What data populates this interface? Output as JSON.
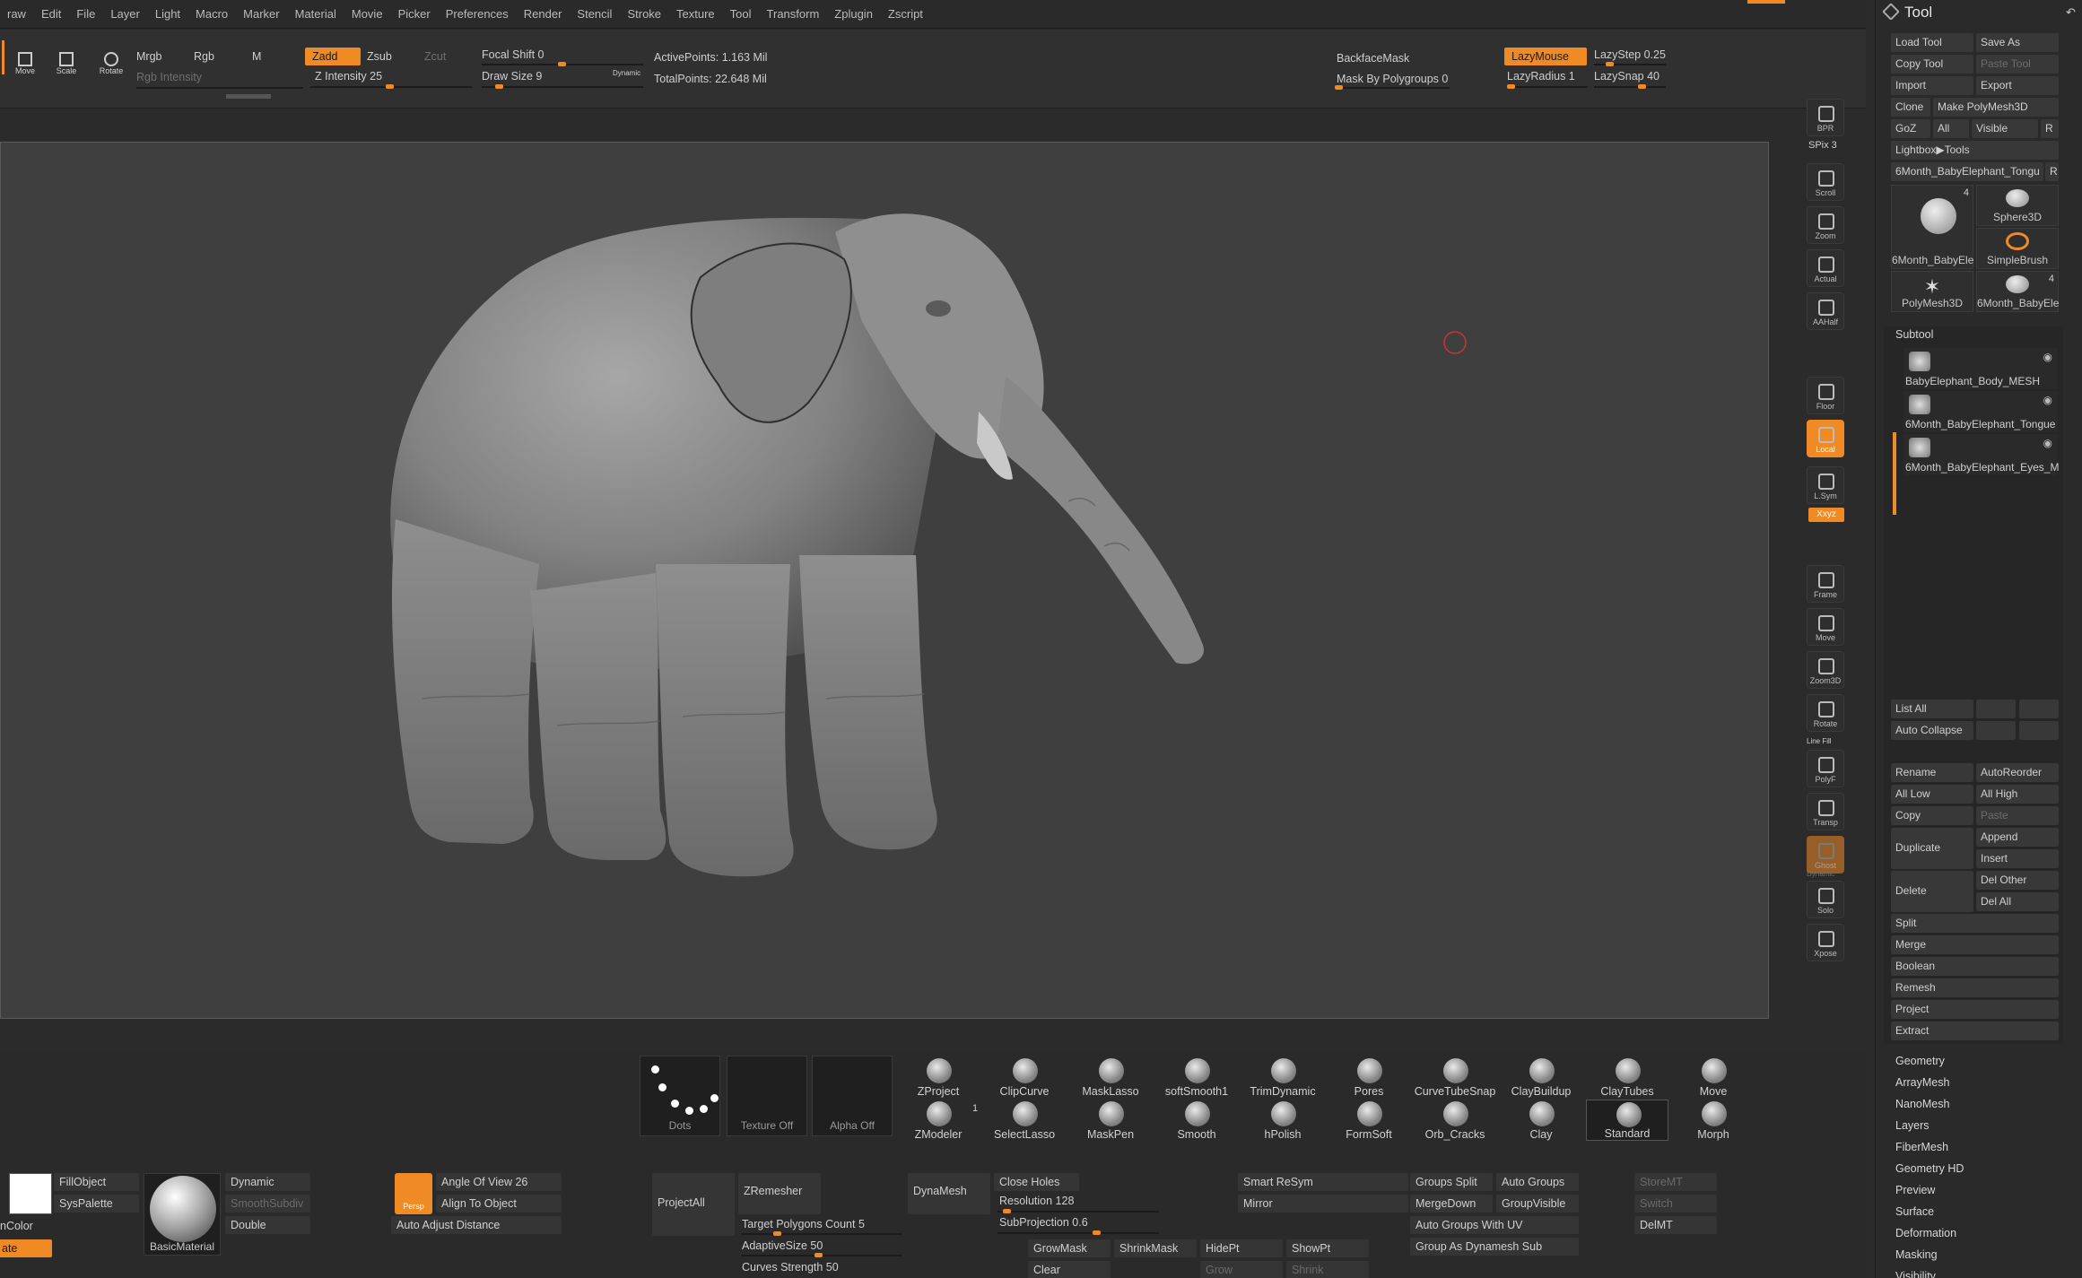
{
  "menu": [
    "raw",
    "Edit",
    "File",
    "Layer",
    "Light",
    "Macro",
    "Marker",
    "Material",
    "Movie",
    "Picker",
    "Preferences",
    "Render",
    "Stencil",
    "Stroke",
    "Texture",
    "Tool",
    "Transform",
    "Zplugin",
    "Zscript"
  ],
  "topshelf": {
    "transform_buttons": [
      "Move",
      "Scale",
      "Rotate"
    ],
    "mrgb": "Mrgb",
    "rgb": "Rgb",
    "m": "M",
    "rgb_intensity": "Rgb Intensity",
    "zadd": "Zadd",
    "zsub": "Zsub",
    "zcut": "Zcut",
    "z_intensity": "Z Intensity 25",
    "focal_shift": "Focal Shift 0",
    "draw_size": "Draw Size 9",
    "dynamic": "Dynamic",
    "active_points": "ActivePoints: 1.163 Mil",
    "total_points": "TotalPoints: 22.648 Mil",
    "backface_mask": "BackfaceMask",
    "mask_by_polygroups": "Mask By Polygroups 0",
    "lazymouse": "LazyMouse",
    "lazystep": "LazyStep 0.25",
    "lazyradius": "LazyRadius 1",
    "lazysnap": "LazySnap 40"
  },
  "right_toolbar": {
    "bpr": "BPR",
    "spix": "SPix 3",
    "scroll": "Scroll",
    "zoom": "Zoom",
    "actual": "Actual",
    "aahalf": "AAHalf",
    "floor": "Floor",
    "local": "Local",
    "lsym": "L.Sym",
    "xyz": "Xxyz",
    "frame": "Frame",
    "move": "Move",
    "zoom3d": "Zoom3D",
    "rotate": "Rotate",
    "linefill": "Line Fill",
    "polyf": "PolyF",
    "transp": "Transp",
    "ghost": "Ghost",
    "dynamic": "Dynamic",
    "solo": "Solo",
    "xpose": "Xpose"
  },
  "tool_panel": {
    "title": "Tool",
    "load_tool": "Load Tool",
    "save_as": "Save As",
    "copy_tool": "Copy Tool",
    "paste_tool": "Paste Tool",
    "import": "Import",
    "export": "Export",
    "clone": "Clone",
    "make_polymesh": "Make PolyMesh3D",
    "goz": "GoZ",
    "all": "All",
    "visible": "Visible",
    "r": "R",
    "lightbox_tools": "Lightbox▶Tools",
    "current_tool": "6Month_BabyElephant_Tongu",
    "current_r": "R",
    "tools": [
      {
        "name": "6Month_BabyEle",
        "count": "4"
      },
      {
        "name": "Sphere3D"
      },
      {
        "name": "SimpleBrush"
      },
      {
        "name": "PolyMesh3D"
      },
      {
        "name": "6Month_BabyEle",
        "count": "4"
      }
    ],
    "subtool_title": "Subtool",
    "subtools": [
      "BabyElephant_Body_MESH",
      "6Month_BabyElephant_Tongue",
      "6Month_BabyElephant_Eyes_M"
    ],
    "list_all": "List All",
    "auto_collapse": "Auto Collapse",
    "rename": "Rename",
    "autoreorder": "AutoReorder",
    "all_low": "All Low",
    "all_high": "All High",
    "copy": "Copy",
    "paste": "Paste",
    "duplicate": "Duplicate",
    "append": "Append",
    "insert": "Insert",
    "delete": "Delete",
    "del_other": "Del Other",
    "del_all": "Del All",
    "sections1": [
      "Split",
      "Merge",
      "Boolean",
      "Remesh",
      "Project",
      "Extract"
    ],
    "sections2": [
      "Geometry",
      "ArrayMesh",
      "NanoMesh",
      "Layers",
      "FiberMesh",
      "Geometry HD",
      "Preview",
      "Surface",
      "Deformation",
      "Masking",
      "Visibility"
    ]
  },
  "bottom": {
    "dots": "Dots",
    "texture_off": "Texture Off",
    "alpha_off": "Alpha Off",
    "brushes_row1": [
      "ZProject",
      "ClipCurve",
      "MaskLasso",
      "softSmooth1",
      "TrimDynamic",
      "Pores",
      "CurveTubeSnap",
      "ClayBuildup",
      "ClayTubes",
      "Move"
    ],
    "brushes_row2": [
      "ZModeler",
      "SelectLasso",
      "MaskPen",
      "Smooth",
      "hPolish",
      "FormSoft",
      "Orb_Cracks",
      "Clay",
      "Standard",
      "Morph"
    ],
    "zmodeler_num": "1",
    "fillobject": "FillObject",
    "syspalette": "SysPalette",
    "color": "nColor",
    "rotate_btn": "ate",
    "basic_material": "BasicMaterial",
    "mat_dynamic": "Dynamic",
    "smooth_subdiv": "SmoothSubdiv",
    "double": "Double",
    "persp": "Persp",
    "angle_of_view": "Angle Of View 26",
    "align_to_object": "Align To Object",
    "auto_adjust_distance": "Auto Adjust Distance",
    "projectall": "ProjectAll",
    "zremesher": "ZRemesher",
    "target_polygons": "Target Polygons Count 5",
    "adaptive_size": "AdaptiveSize 50",
    "curves_strength": "Curves Strength 50",
    "dynamesh": "DynaMesh",
    "close_holes": "Close Holes",
    "resolution": "Resolution 128",
    "subprojection": "SubProjection 0.6",
    "growmask": "GrowMask",
    "shrinkmask": "ShrinkMask",
    "hidept": "HidePt",
    "showpt": "ShowPt",
    "clear": "Clear",
    "grow": "Grow",
    "shrink": "Shrink",
    "smart_resym": "Smart ReSym",
    "mirror": "Mirror",
    "groups_split": "Groups Split",
    "auto_groups": "Auto Groups",
    "mergedown": "MergeDown",
    "groupvisible": "GroupVisible",
    "auto_groups_uv": "Auto Groups With UV",
    "group_as_dynamesh": "Group As Dynamesh Sub",
    "storemt": "StoreMT",
    "switch": "Switch",
    "delmt": "DelMT"
  },
  "colors": {
    "accent": "#f08a24",
    "canvas": "#3f3f3f",
    "panel": "#2a2a2a"
  }
}
